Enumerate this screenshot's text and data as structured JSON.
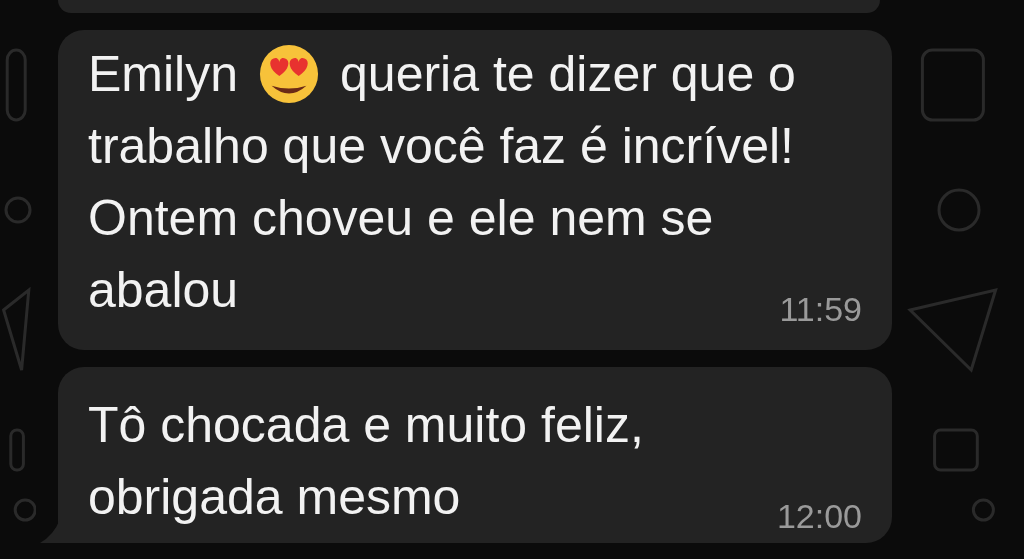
{
  "messages": [
    {
      "kind": "cut"
    },
    {
      "kind": "text",
      "first_line": {
        "before_emoji": "Emilyn",
        "after_emoji": "queria te dizer que o"
      },
      "lines": [
        "trabalho que você faz é incrível!",
        "Ontem choveu e ele nem se",
        "abalou"
      ],
      "time": "11:59",
      "tail": false
    },
    {
      "kind": "text",
      "lines": [
        "Tô chocada e muito feliz,",
        "obrigada mesmo"
      ],
      "time": "12:00",
      "tail": true
    }
  ]
}
